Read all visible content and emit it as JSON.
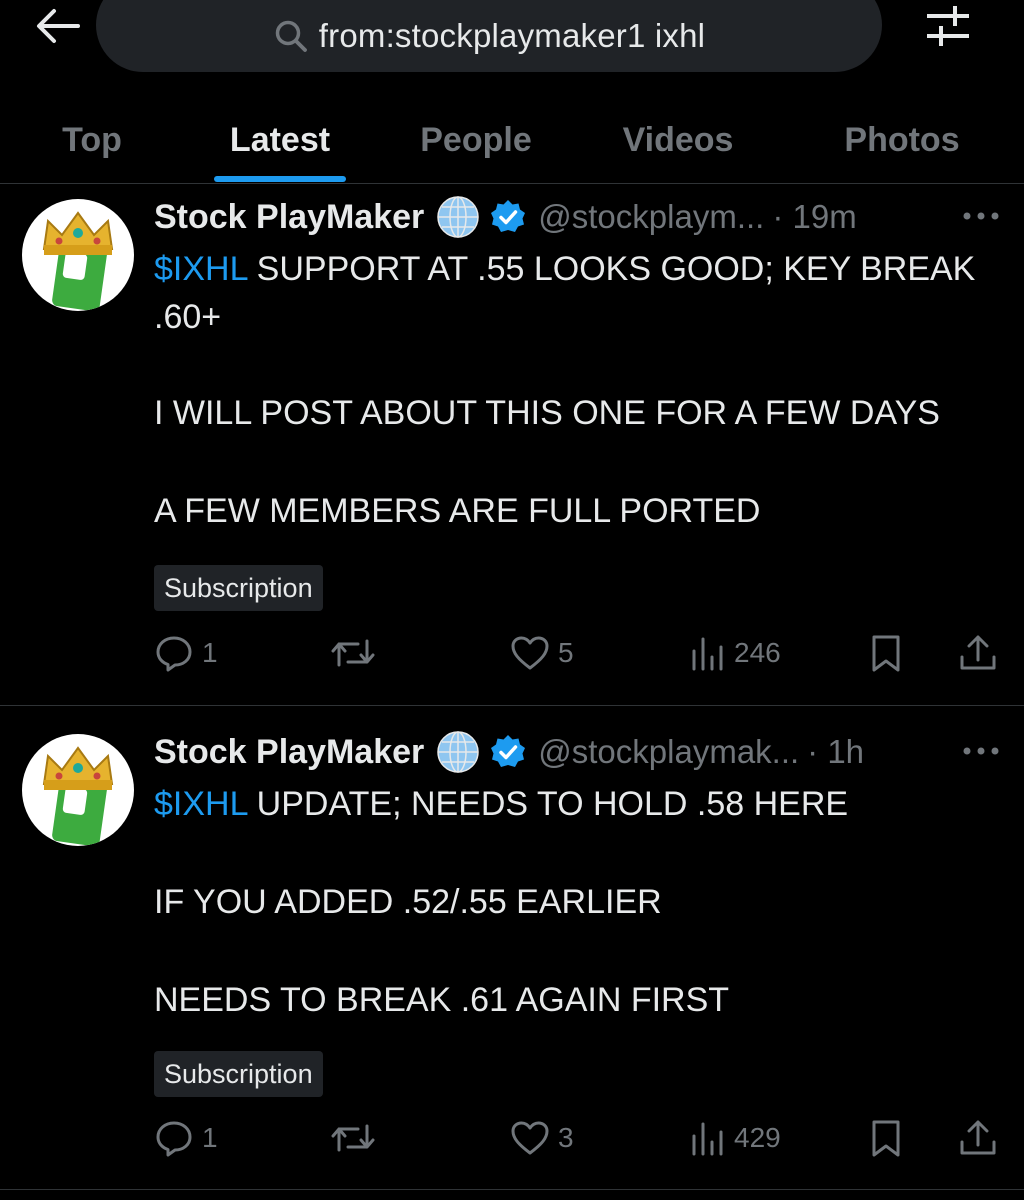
{
  "header": {
    "search_query": "from:stockplaymaker1 ixhl",
    "icons": {
      "back": "arrow-left-icon",
      "search": "search-icon",
      "filter": "sliders-icon"
    }
  },
  "tabs": [
    {
      "label": "Top",
      "active": false
    },
    {
      "label": "Latest",
      "active": true
    },
    {
      "label": "People",
      "active": false
    },
    {
      "label": "Videos",
      "active": false
    },
    {
      "label": "Photos",
      "active": false
    }
  ],
  "colors": {
    "background": "#000000",
    "accent": "#1d9bf0",
    "text": "#e7e9ea",
    "muted": "#71767b"
  },
  "tweets": [
    {
      "author_name": "Stock PlayMaker",
      "handle": "@stockplaym...",
      "time": "· 19m",
      "cashtag": "$IXHL",
      "first_line_rest": " SUPPORT AT .55 LOOKS GOOD; KEY BREAK .60+",
      "paragraphs": [
        "I WILL POST ABOUT THIS ONE FOR A FEW DAYS",
        "A FEW MEMBERS ARE FULL PORTED"
      ],
      "badge": "Subscription",
      "replies": "1",
      "likes": "5",
      "views": "246"
    },
    {
      "author_name": "Stock PlayMaker",
      "handle": "@stockplaymak...",
      "time": "· 1h",
      "cashtag": "$IXHL",
      "first_line_rest": " UPDATE; NEEDS TO HOLD .58 HERE",
      "paragraphs": [
        "IF YOU ADDED .52/.55 EARLIER",
        "NEEDS TO BREAK .61 AGAIN FIRST"
      ],
      "badge": "Subscription",
      "replies": "1",
      "likes": "3",
      "views": "429"
    }
  ]
}
